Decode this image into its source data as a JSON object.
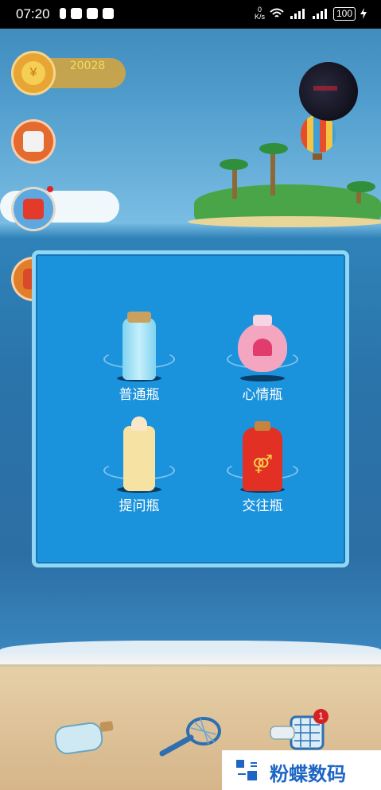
{
  "status_bar": {
    "time": "07:20",
    "net_speed_top": "0",
    "net_speed_unit": "K/s",
    "battery": "100"
  },
  "coins": {
    "value": "20028"
  },
  "badge": {
    "count": "1"
  },
  "dialog": {
    "options": [
      {
        "label": "普通瓶",
        "icon": "plain-bottle-icon"
      },
      {
        "label": "心情瓶",
        "icon": "heart-bottle-icon"
      },
      {
        "label": "提问瓶",
        "icon": "question-bottle-icon"
      },
      {
        "label": "交往瓶",
        "icon": "dating-bottle-icon"
      }
    ]
  },
  "bottom_bar": {
    "items": [
      "throw-bottle-icon",
      "fishing-net-icon",
      "my-bottles-icon"
    ]
  },
  "watermark": {
    "text": "粉蝶数码"
  },
  "colors": {
    "dialog_bg": "#1b93dc",
    "dialog_border": "#8fd7f5",
    "badge": "#d42222"
  }
}
